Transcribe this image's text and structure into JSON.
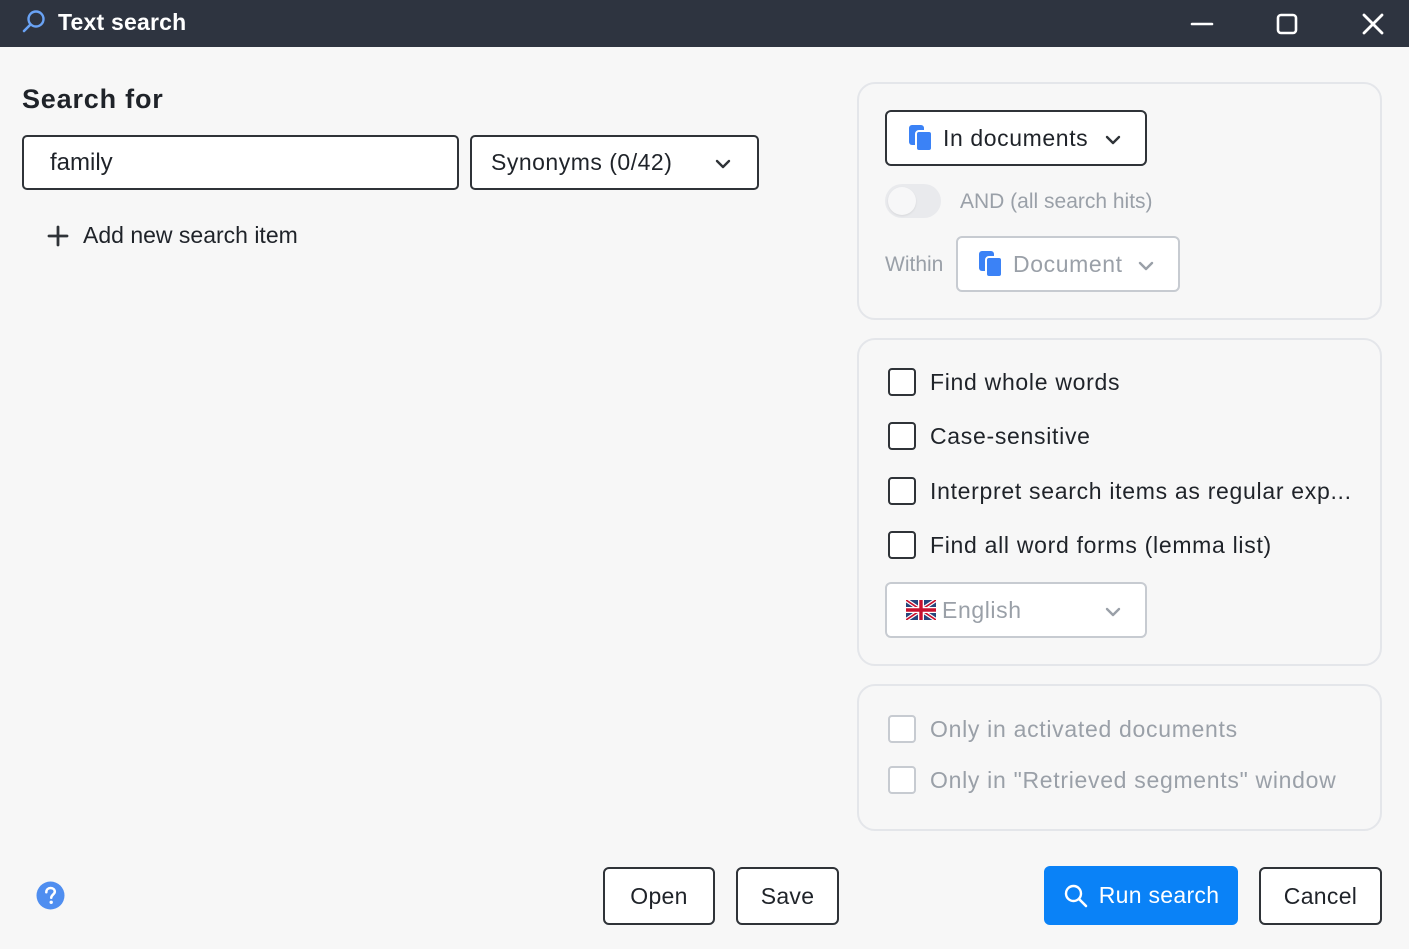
{
  "window": {
    "title": "Text search",
    "title_icon": "search-icon",
    "controls": [
      "minimize-icon",
      "maximize-icon",
      "close-icon"
    ]
  },
  "colors": {
    "titlebar_bg": "#2e3440",
    "primary_button": "#0a82f7",
    "disabled_text": "#9aa0a8",
    "icon_blue": "#3b82f6"
  },
  "search": {
    "heading": "Search for",
    "input_value": "family",
    "synonyms_label": "Synonyms (0/42)",
    "add_item_label": "Add new search item"
  },
  "scope": {
    "location_label": "In documents",
    "location_icon": "documents-icon",
    "and_toggle_label": "AND (all search hits)",
    "and_toggle_on": false,
    "within_label": "Within",
    "within_value": "Document",
    "within_icon": "documents-icon"
  },
  "options": {
    "checkboxes": [
      {
        "label": "Find whole words",
        "checked": false
      },
      {
        "label": "Case-sensitive",
        "checked": false
      },
      {
        "label": "Interpret search items as regular exp...",
        "checked": false
      },
      {
        "label": "Find all word forms (lemma list)",
        "checked": false
      }
    ],
    "language": "English",
    "language_icon": "uk-flag-icon"
  },
  "filters": {
    "checkboxes": [
      {
        "label": "Only in activated documents",
        "checked": false,
        "disabled": true
      },
      {
        "label": "Only in \"Retrieved segments\" window",
        "checked": false,
        "disabled": true
      }
    ]
  },
  "footer": {
    "help_icon": "help-icon",
    "open_label": "Open",
    "save_label": "Save",
    "run_label": "Run search",
    "cancel_label": "Cancel"
  }
}
